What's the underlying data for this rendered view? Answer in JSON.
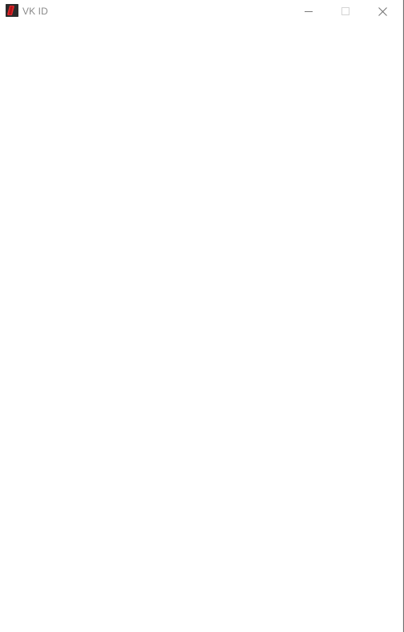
{
  "window": {
    "title": "VK ID",
    "app_icon": "vk-id-app-icon",
    "controls": {
      "minimize_icon": "minimize-icon",
      "maximize_icon": "maximize-icon",
      "close_icon": "close-icon"
    }
  },
  "colors": {
    "titlebar_bg": "#ffffff",
    "title_text": "#8a8a8a",
    "app_icon_bg": "#2b2b2b",
    "app_icon_accent": "#e0262b",
    "content_bg": "#ffffff"
  }
}
